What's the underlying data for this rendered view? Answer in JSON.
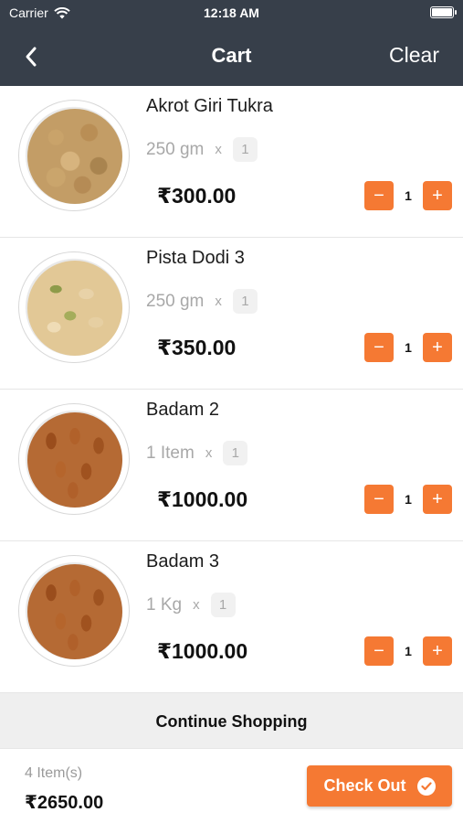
{
  "status_bar": {
    "carrier": "Carrier",
    "time": "12:18 AM"
  },
  "nav": {
    "title": "Cart",
    "clear_label": "Clear",
    "back_icon": "chevron-left-icon"
  },
  "items": [
    {
      "name": "Akrot Giri Tukra",
      "variant": "250 gm",
      "times": "x",
      "variant_qty": "1",
      "price": "₹300.00",
      "qty": "1",
      "image": "walnut"
    },
    {
      "name": "Pista Dodi 3",
      "variant": "250 gm",
      "times": "x",
      "variant_qty": "1",
      "price": "₹350.00",
      "qty": "1",
      "image": "pista"
    },
    {
      "name": "Badam 2",
      "variant": "1 Item",
      "times": "x",
      "variant_qty": "1",
      "price": "₹1000.00",
      "qty": "1",
      "image": "almond"
    },
    {
      "name": "Badam 3",
      "variant": "1 Kg",
      "times": "x",
      "variant_qty": "1",
      "price": "₹1000.00",
      "qty": "1",
      "image": "almond"
    }
  ],
  "stepper": {
    "minus": "−",
    "plus": "+"
  },
  "continue_label": "Continue Shopping",
  "footer": {
    "count": "4 Item(s)",
    "total": "₹2650.00",
    "checkout_label": "Check Out"
  },
  "colors": {
    "header": "#373f4a",
    "accent": "#f57933"
  }
}
